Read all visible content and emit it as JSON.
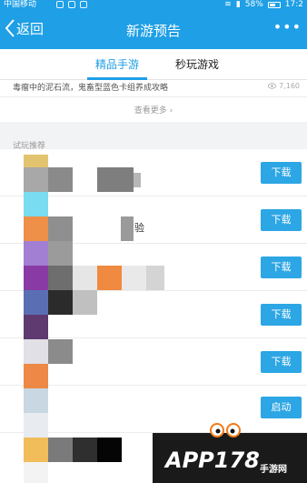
{
  "status_bar": {
    "carrier": "中国移动",
    "battery": "58%",
    "time": "17:2"
  },
  "nav": {
    "back_label": "返回",
    "title": "新游预告",
    "more": "•••"
  },
  "tabs": [
    {
      "label": "精品手游",
      "active": true
    },
    {
      "label": "秒玩游戏",
      "active": false
    }
  ],
  "article": {
    "text": "毒瘤中的泥石流，鬼畜型蓝色卡组养成攻略",
    "views": "7,160"
  },
  "see_more": "查看更多",
  "section_label": "试玩推荐",
  "fragments": {
    "row2": "验"
  },
  "list_items": [
    {
      "button": "下载"
    },
    {
      "button": "下载"
    },
    {
      "button": "下载"
    },
    {
      "button": "下载"
    },
    {
      "button": "下载"
    },
    {
      "button": "启动"
    }
  ],
  "watermark": {
    "logo": "APP178",
    "sub": "手游网"
  }
}
